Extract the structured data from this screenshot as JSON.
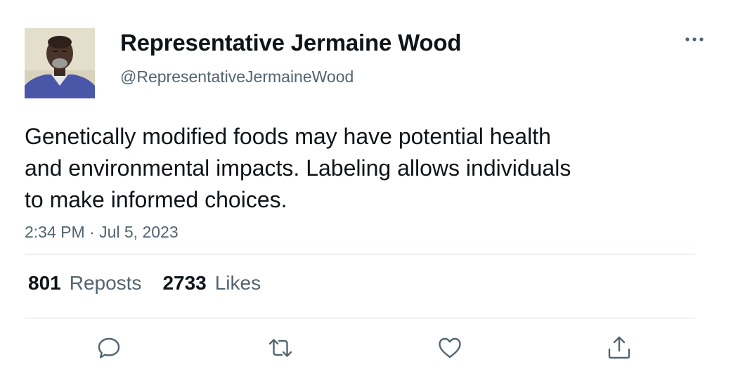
{
  "author": {
    "display_name": "Representative Jermaine Wood",
    "handle": "@RepresentativeJermaineWood"
  },
  "tweet": {
    "text": "Genetically modified foods may have potential health\nand environmental impacts. Labeling allows individuals\nto make informed choices.",
    "timestamp": "2:34 PM · Jul 5, 2023"
  },
  "stats": {
    "reposts_count": "801",
    "reposts_label": "Reposts",
    "likes_count": "2733",
    "likes_label": "Likes"
  },
  "icons": {
    "more": "more-horizontal-icon",
    "reply": "reply-icon",
    "repost": "repost-icon",
    "like": "heart-icon",
    "share": "share-icon"
  },
  "colors": {
    "text_primary": "#0f1419",
    "text_secondary": "#536471",
    "divider": "#cfd9de",
    "icon": "#536471"
  }
}
